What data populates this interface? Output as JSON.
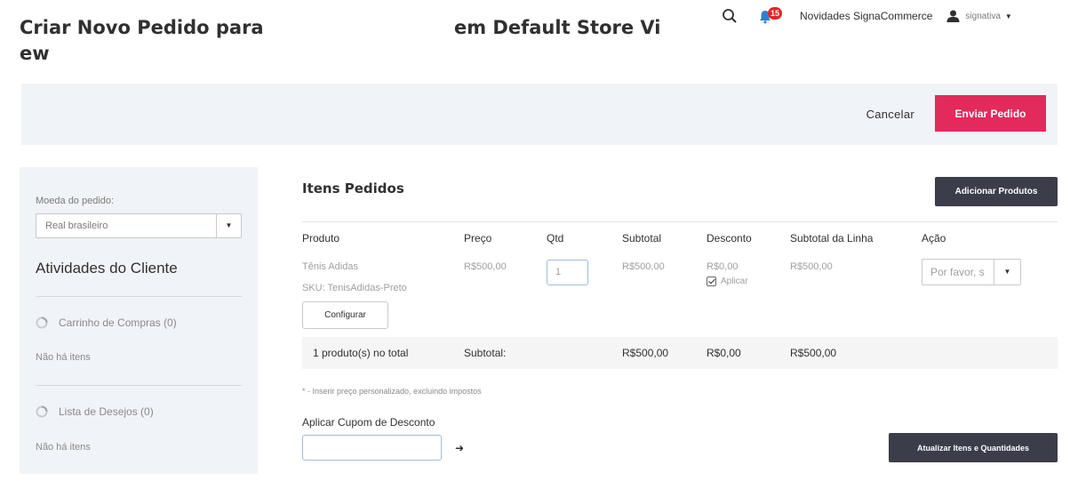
{
  "header": {
    "title": "Criar Novo Pedido para ew",
    "store_title": "em Default Store Vi",
    "notification_count": "15",
    "news_link": "Novidades SignaCommerce",
    "user_name": "signativa"
  },
  "actions": {
    "cancel_label": "Cancelar",
    "submit_label": "Enviar Pedido"
  },
  "sidebar": {
    "currency_label": "Moeda do pedido:",
    "currency_value": "Real brasileiro",
    "activities_heading": "Atividades do Cliente",
    "cart_label": "Carrinho de Compras (0)",
    "cart_empty": "Não há itens",
    "wishlist_label": "Lista de Desejos (0)",
    "wishlist_empty": "Não há itens"
  },
  "items": {
    "title": "Itens Pedidos",
    "add_products_label": "Adicionar Produtos",
    "columns": [
      "Produto",
      "Preço",
      "Qtd",
      "Subtotal",
      "Desconto",
      "Subtotal da Linha",
      "Ação"
    ],
    "rows": [
      {
        "product": "Tênis Adidas",
        "sku": "SKU: TenisAdidas-Preto",
        "price": "R$500,00",
        "qty": "1",
        "subtotal": "R$500,00",
        "discount": "R$0,00",
        "apply_label": "Aplicar",
        "apply_checked": true,
        "line_subtotal": "R$500,00",
        "action_value": "Por favor, s",
        "configure_label": "Configurar"
      }
    ],
    "totals": {
      "count_text": "1 produto(s) no total",
      "subtotal_label": "Subtotal:",
      "subtotal": "R$500,00",
      "discount": "R$0,00",
      "line_subtotal": "R$500,00"
    },
    "note": "* - Inserir preço personalizado, excluindo impostos",
    "coupon_label": "Aplicar Cupom de Desconto",
    "coupon_value": "",
    "update_label": "Atualizar Itens e Quantidades"
  },
  "colors": {
    "accent": "#e22a5d",
    "dark_button": "#3b3d4a",
    "panel_bg": "#f0f3f7",
    "badge": "#e22626"
  },
  "icons": {
    "search": "search-icon",
    "notification": "bell-icon",
    "user": "user-icon",
    "loading": "spinner-icon",
    "arrow": "arrow-right-icon"
  }
}
